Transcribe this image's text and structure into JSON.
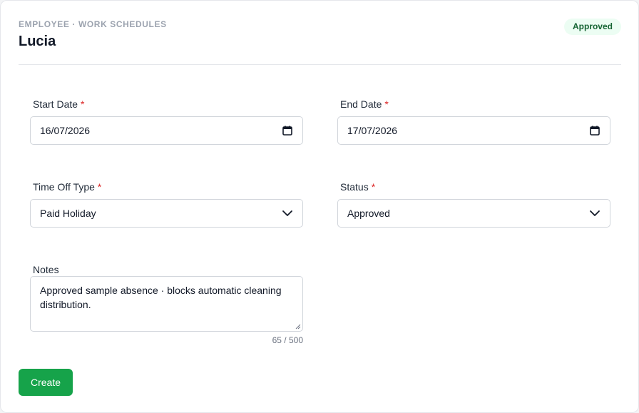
{
  "header": {
    "overline": "EMPLOYEE · WORK SCHEDULES",
    "title": "Lucia",
    "status_badge": "Approved"
  },
  "form": {
    "start_date": {
      "label": "Start Date",
      "required_mark": "*",
      "value": "16/07/2026",
      "icon": "calendar-icon"
    },
    "end_date": {
      "label": "End Date",
      "required_mark": "*",
      "value": "17/07/2026",
      "icon": "calendar-icon"
    },
    "time_off_type": {
      "label": "Time Off Type",
      "required_mark": "*",
      "value": "Paid Holiday",
      "icon": "chevron-down-icon"
    },
    "status": {
      "label": "Status",
      "required_mark": "*",
      "value": "Approved",
      "icon": "chevron-down-icon"
    },
    "notes": {
      "label": "Notes",
      "value": "Approved sample absence · blocks automatic cleaning distribution.",
      "counter": "65 / 500"
    },
    "submit_label": "Create"
  },
  "colors": {
    "accent": "#16a34a",
    "badge_bg": "#ecfdf3",
    "badge_text": "#166534",
    "required": "#dc2626"
  }
}
